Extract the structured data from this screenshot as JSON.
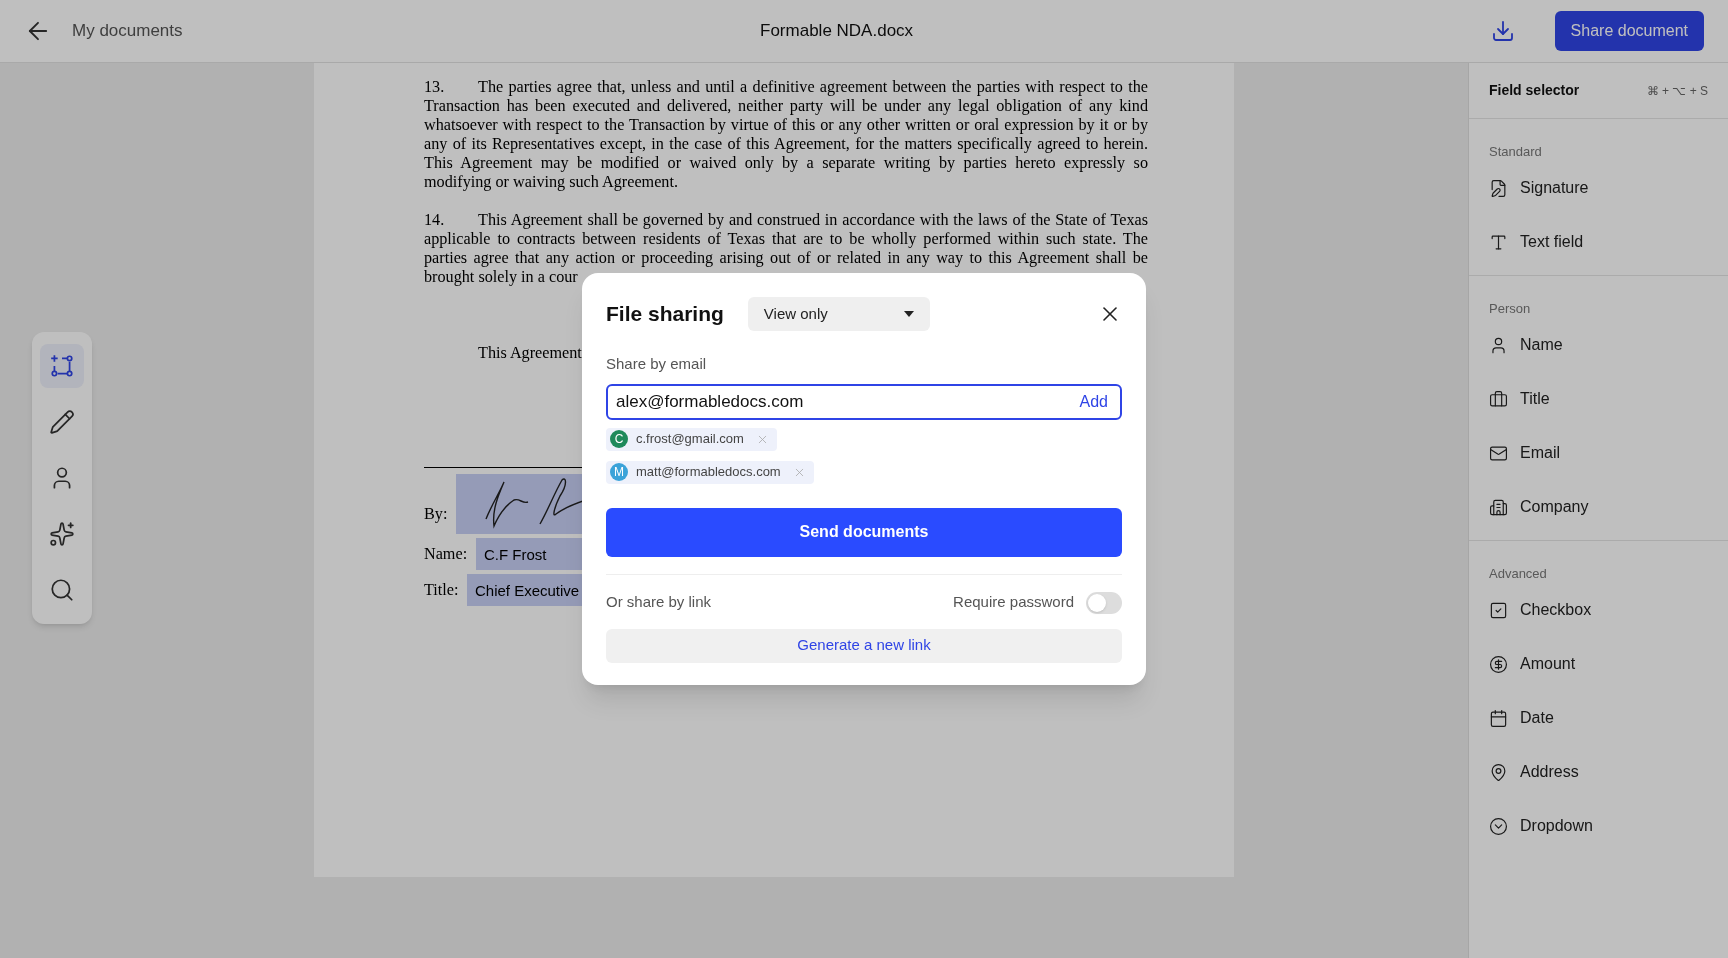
{
  "header": {
    "back_label": "My documents",
    "title": "Formable NDA.docx",
    "share_button": "Share document"
  },
  "toolbar": [
    {
      "selected": true
    },
    {
      "selected": false
    },
    {
      "selected": false
    },
    {
      "selected": false
    },
    {
      "selected": false
    }
  ],
  "document": {
    "paragraphs": [
      {
        "number": "13.",
        "text": "The parties agree that, unless and until a definitive agreement between the parties with respect to the Transaction has been executed and delivered, neither party will be under any legal obligation of any kind whatsoever with respect to the Transaction by virtue of this or any other written or oral expression by it or by any of its Representatives except, in the case of this Agreement, for the matters specifically agreed to herein. This Agreement may be modified or waived only by a separate writing by parties hereto expressly so modifying or waiving such Agreement."
      },
      {
        "number": "14.",
        "text": "This Agreement shall be governed by and construed in accordance with the laws of the State of Texas applicable to contracts between residents of Texas that are to be wholly performed within such state. The parties agree that any action or proceeding arising out of or related in any way to this Agreement shall be brought solely in a cour"
      }
    ],
    "partial_line": "This Agreement",
    "signature": {
      "by_label": "By:",
      "name_label": "Name:",
      "name_value": "C.F Frost",
      "title_label": "Title:",
      "title_value": "Chief Executive"
    }
  },
  "sidebar": {
    "title": "Field selector",
    "shortcut": "⌘ + ⌥ + S",
    "sections": [
      {
        "heading": "Standard",
        "items": [
          "Signature",
          "Text field"
        ]
      },
      {
        "heading": "Person",
        "items": [
          "Name",
          "Title",
          "Email",
          "Company"
        ]
      },
      {
        "heading": "Advanced",
        "items": [
          "Checkbox",
          "Amount",
          "Date",
          "Address",
          "Dropdown"
        ]
      }
    ]
  },
  "dialog": {
    "title": "File sharing",
    "access": "View only",
    "email_label": "Share by email",
    "email_value": "alex@formabledocs.com",
    "add_button": "Add",
    "recipients": [
      {
        "initial": "C",
        "email": "c.frost@gmail.com",
        "color": "#1f8a5b"
      },
      {
        "initial": "M",
        "email": "matt@formabledocs.com",
        "color": "#3ba3d9"
      }
    ],
    "send_button": "Send documents",
    "link_label": "Or share by link",
    "password_label": "Require password",
    "password_required": false,
    "generate_button": "Generate a new link"
  }
}
